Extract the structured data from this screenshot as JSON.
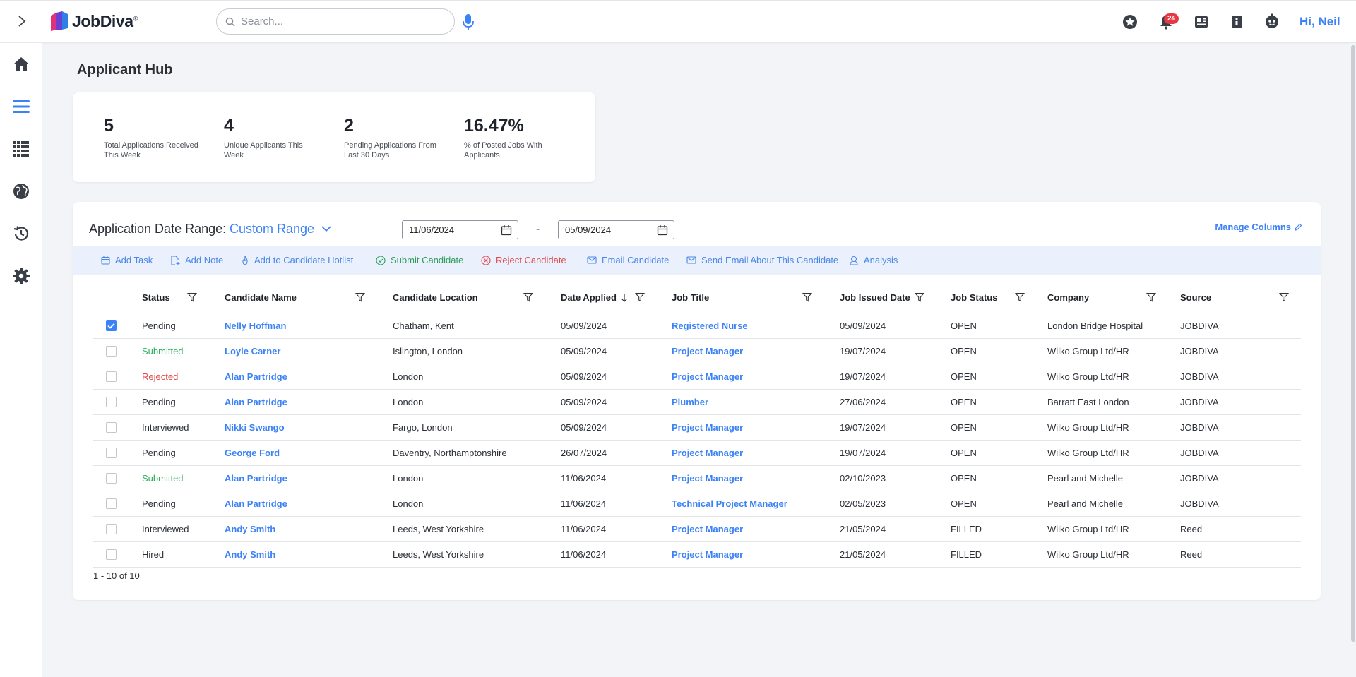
{
  "app": {
    "name": "JobDiva",
    "reg_mark": "®",
    "greeting": "Hi, Neil",
    "notification_count": "24"
  },
  "search": {
    "placeholder": "Search..."
  },
  "page": {
    "title": "Applicant Hub"
  },
  "stats": [
    {
      "value": "5",
      "label": "Total Applications Received This Week"
    },
    {
      "value": "4",
      "label": "Unique Applicants This Week"
    },
    {
      "value": "2",
      "label": "Pending Applications From Last 30 Days"
    },
    {
      "value": "16.47%",
      "label": "% of Posted Jobs With Applicants"
    }
  ],
  "filters": {
    "range_label": "Application Date Range:",
    "range_value": "Custom Range",
    "start_date": "11/06/2024",
    "separator": "-",
    "end_date": "05/09/2024",
    "manage_columns": "Manage Columns"
  },
  "actions": {
    "add_task": "Add Task",
    "add_note": "Add Note",
    "add_hotlist": "Add to Candidate Hotlist",
    "submit": "Submit Candidate",
    "reject": "Reject Candidate",
    "email": "Email Candidate",
    "send_email": "Send Email About This Candidate",
    "analysis": "Analysis"
  },
  "table": {
    "columns": {
      "status": "Status",
      "candidate_name": "Candidate Name",
      "candidate_location": "Candidate Location",
      "date_applied": "Date Applied",
      "job_title": "Job Title",
      "job_issued_date": "Job Issued Date",
      "job_status": "Job Status",
      "company": "Company",
      "source": "Source"
    },
    "rows": [
      {
        "checked": true,
        "status": "Pending",
        "name": "Nelly Hoffman",
        "location": "Chatham, Kent",
        "date_applied": "05/09/2024",
        "job_title": "Registered Nurse",
        "job_issued": "05/09/2024",
        "job_status": "OPEN",
        "company": "London Bridge Hospital",
        "source": "JOBDIVA"
      },
      {
        "checked": false,
        "status": "Submitted",
        "name": "Loyle Carner",
        "location": "Islington, London",
        "date_applied": "05/09/2024",
        "job_title": "Project Manager",
        "job_issued": "19/07/2024",
        "job_status": "OPEN",
        "company": "Wilko Group Ltd/HR",
        "source": "JOBDIVA"
      },
      {
        "checked": false,
        "status": "Rejected",
        "name": "Alan Partridge",
        "location": "London",
        "date_applied": "05/09/2024",
        "job_title": "Project Manager",
        "job_issued": "19/07/2024",
        "job_status": "OPEN",
        "company": "Wilko Group Ltd/HR",
        "source": "JOBDIVA"
      },
      {
        "checked": false,
        "status": "Pending",
        "name": "Alan Partridge",
        "location": "London",
        "date_applied": "05/09/2024",
        "job_title": "Plumber",
        "job_issued": "27/06/2024",
        "job_status": "OPEN",
        "company": "Barratt East London",
        "source": "JOBDIVA"
      },
      {
        "checked": false,
        "status": "Interviewed",
        "name": "Nikki Swango",
        "location": "Fargo, London",
        "date_applied": "05/09/2024",
        "job_title": "Project Manager",
        "job_issued": "19/07/2024",
        "job_status": "OPEN",
        "company": "Wilko Group Ltd/HR",
        "source": "JOBDIVA"
      },
      {
        "checked": false,
        "status": "Pending",
        "name": "George Ford",
        "location": "Daventry, Northamptonshire",
        "date_applied": "26/07/2024",
        "job_title": "Project Manager",
        "job_issued": "19/07/2024",
        "job_status": "OPEN",
        "company": "Wilko Group Ltd/HR",
        "source": "JOBDIVA"
      },
      {
        "checked": false,
        "status": "Submitted",
        "name": "Alan Partridge",
        "location": "London",
        "date_applied": "11/06/2024",
        "job_title": "Project Manager",
        "job_issued": "02/10/2023",
        "job_status": "OPEN",
        "company": "Pearl and Michelle",
        "source": "JOBDIVA"
      },
      {
        "checked": false,
        "status": "Pending",
        "name": "Alan Partridge",
        "location": "London",
        "date_applied": "11/06/2024",
        "job_title": "Technical Project Manager",
        "job_issued": "02/05/2023",
        "job_status": "OPEN",
        "company": "Pearl and Michelle",
        "source": "JOBDIVA"
      },
      {
        "checked": false,
        "status": "Interviewed",
        "name": "Andy Smith",
        "location": "Leeds, West Yorkshire",
        "date_applied": "11/06/2024",
        "job_title": "Project Manager",
        "job_issued": "21/05/2024",
        "job_status": "FILLED",
        "company": "Wilko Group Ltd/HR",
        "source": "Reed"
      },
      {
        "checked": false,
        "status": "Hired",
        "name": "Andy Smith",
        "location": "Leeds, West Yorkshire",
        "date_applied": "11/06/2024",
        "job_title": "Project Manager",
        "job_issued": "21/05/2024",
        "job_status": "FILLED",
        "company": "Wilko Group Ltd/HR",
        "source": "Reed"
      }
    ],
    "pagination": "1 - 10 of 10"
  },
  "colors": {
    "accent": "#3b82f6",
    "submitted": "#2eaf5c",
    "rejected": "#e0484a",
    "action_bar": "#eaf1fc"
  }
}
